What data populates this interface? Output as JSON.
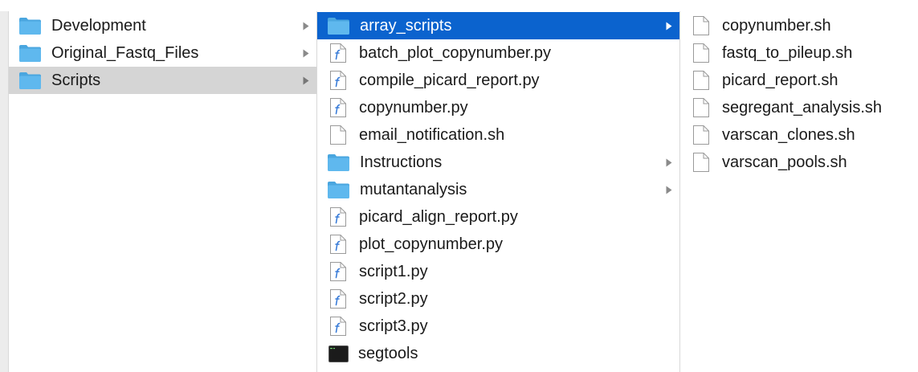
{
  "columns": [
    {
      "items": [
        {
          "label": "Development",
          "type": "folder",
          "has_children": true,
          "selected": false
        },
        {
          "label": "Original_Fastq_Files",
          "type": "folder",
          "has_children": true,
          "selected": false
        },
        {
          "label": "Scripts",
          "type": "folder",
          "has_children": true,
          "selected": "inactive"
        }
      ]
    },
    {
      "items": [
        {
          "label": "array_scripts",
          "type": "folder",
          "has_children": true,
          "selected": "active"
        },
        {
          "label": "batch_plot_copynumber.py",
          "type": "python",
          "has_children": false,
          "selected": false
        },
        {
          "label": "compile_picard_report.py",
          "type": "python",
          "has_children": false,
          "selected": false
        },
        {
          "label": "copynumber.py",
          "type": "python",
          "has_children": false,
          "selected": false
        },
        {
          "label": "email_notification.sh",
          "type": "document",
          "has_children": false,
          "selected": false
        },
        {
          "label": "Instructions",
          "type": "folder",
          "has_children": true,
          "selected": false
        },
        {
          "label": "mutantanalysis",
          "type": "folder",
          "has_children": true,
          "selected": false
        },
        {
          "label": "picard_align_report.py",
          "type": "python",
          "has_children": false,
          "selected": false
        },
        {
          "label": "plot_copynumber.py",
          "type": "python",
          "has_children": false,
          "selected": false
        },
        {
          "label": "script1.py",
          "type": "python",
          "has_children": false,
          "selected": false
        },
        {
          "label": "script2.py",
          "type": "python",
          "has_children": false,
          "selected": false
        },
        {
          "label": "script3.py",
          "type": "python",
          "has_children": false,
          "selected": false
        },
        {
          "label": "segtools",
          "type": "terminal",
          "has_children": false,
          "selected": false
        }
      ]
    },
    {
      "items": [
        {
          "label": "copynumber.sh",
          "type": "document",
          "has_children": false,
          "selected": false
        },
        {
          "label": "fastq_to_pileup.sh",
          "type": "document",
          "has_children": false,
          "selected": false
        },
        {
          "label": "picard_report.sh",
          "type": "document",
          "has_children": false,
          "selected": false
        },
        {
          "label": "segregant_analysis.sh",
          "type": "document",
          "has_children": false,
          "selected": false
        },
        {
          "label": "varscan_clones.sh",
          "type": "document",
          "has_children": false,
          "selected": false
        },
        {
          "label": "varscan_pools.sh",
          "type": "document",
          "has_children": false,
          "selected": false
        }
      ]
    }
  ],
  "colors": {
    "selection_active": "#0b63ce",
    "selection_inactive": "#d5d5d5",
    "folder_blue": "#5fb8ee",
    "python_blue": "#3b7dd8"
  },
  "icons": {
    "folder": "folder-icon",
    "python": "python-file-icon",
    "document": "document-icon",
    "terminal": "terminal-icon",
    "disclosure": "chevron-right-icon"
  }
}
